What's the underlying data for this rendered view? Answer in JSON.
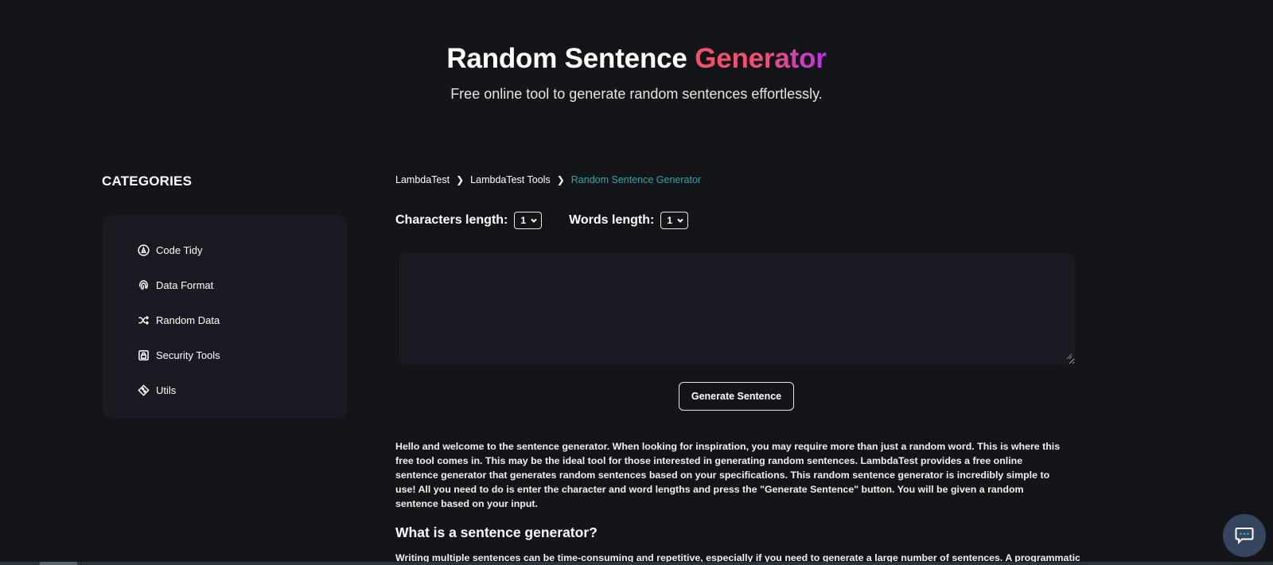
{
  "hero": {
    "title_main": "Random Sentence ",
    "title_accent": "Generator",
    "subtitle": "Free online tool to generate random sentences effortlessly."
  },
  "sidebar": {
    "title": "CATEGORIES",
    "items": [
      {
        "label": "Code Tidy",
        "icon": "code-tidy-icon"
      },
      {
        "label": "Data Format",
        "icon": "fingerprint-icon"
      },
      {
        "label": "Random Data",
        "icon": "shuffle-icon"
      },
      {
        "label": "Security Tools",
        "icon": "lock-icon"
      },
      {
        "label": "Utils",
        "icon": "git-diamond-icon"
      }
    ]
  },
  "breadcrumb": {
    "items": [
      "LambdaTest",
      "LambdaTest Tools"
    ],
    "current": "Random Sentence Generator",
    "separator_icon": "chevron-right-icon"
  },
  "controls": {
    "characters_label": "Characters length:",
    "characters_value": "1",
    "words_label": "Words length:",
    "words_value": "1"
  },
  "output": {
    "value": "",
    "placeholder": ""
  },
  "generate_button": "Generate Sentence",
  "description": "Hello and welcome to the sentence generator. When looking for inspiration, you may require more than just a random word. This is where this free tool comes in. This may be the ideal tool for those interested in generating random sentences. LambdaTest provides a free online sentence generator that generates random sentences based on your specifications. This random sentence generator is incredibly simple to use! All you need to do is enter the character and word lengths and press the \"Generate Sentence\" button. You will be given a random sentence based on your input.",
  "section": {
    "heading": "What is a sentence generator?",
    "text": "Writing multiple sentences can be time-consuming and repetitive, especially if you need to generate a large number of sentences. A programmatic"
  },
  "colors": {
    "background": "#141518",
    "panel": "#1a1a22",
    "breadcrumb_current": "#2aa5b5",
    "accent_start": "#f2506a",
    "accent_end": "#b733e8",
    "chat_bubble": "#354560"
  }
}
